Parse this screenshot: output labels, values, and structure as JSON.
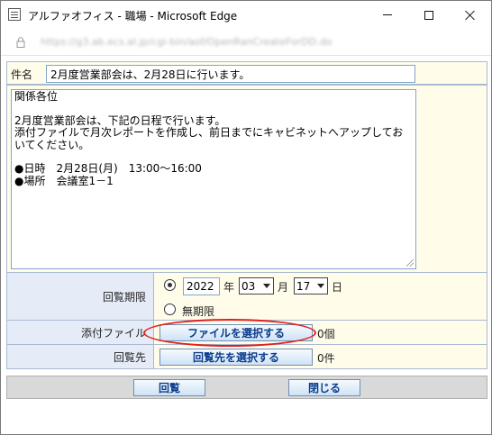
{
  "window": {
    "title": "アルファオフィス - 職場 - Microsoft Edge",
    "url": "https://g3.ab.ecs.al.jp/cgi-bin/aof/OpenRanCreateForDD.do"
  },
  "form": {
    "subject_label": "件名",
    "subject_value": "2月度営業部会は、2月28日に行います。",
    "body_text": "関係各位\n\n2月度営業部会は、下記の日程で行います。\n添付ファイルで月次レポートを作成し、前日までにキャビネットへアップしておいてください。\n\n●日時　2月28日(月)　13:00〜16:00\n●場所　会議室1－1",
    "deadline": {
      "label": "回覧期限",
      "year": "2022",
      "year_unit": "年",
      "month": "03",
      "month_unit": "月",
      "day": "17",
      "day_unit": "日",
      "no_deadline_label": "無期限"
    },
    "attachment": {
      "label": "添付ファイル",
      "button_label": "ファイルを選択する",
      "count": "0個"
    },
    "recipients": {
      "label": "回覧先",
      "button_label": "回覧先を選択する",
      "count": "0件"
    }
  },
  "footer": {
    "circulate_button": "回覧",
    "close_button": "閉じる"
  },
  "colors": {
    "highlight": "#e02020",
    "label_bg": "#e6ecf7",
    "value_bg": "#fffcea"
  }
}
